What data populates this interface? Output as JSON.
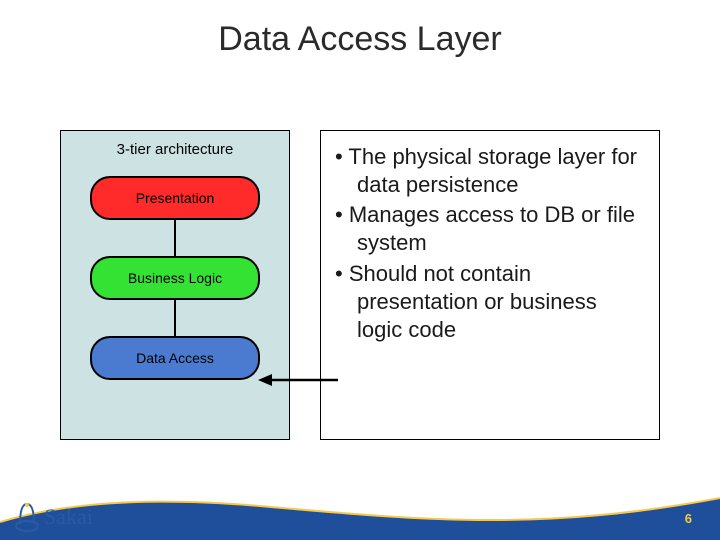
{
  "slide": {
    "title": "Data Access Layer",
    "page_number": "6"
  },
  "diagram": {
    "title": "3-tier architecture",
    "tiers": [
      {
        "label": "Presentation",
        "color": "#ff2a2a"
      },
      {
        "label": "Business Logic",
        "color": "#33e233"
      },
      {
        "label": "Data Access",
        "color": "#4a7bd0"
      }
    ]
  },
  "bullets": [
    "The physical storage layer for data persistence",
    "Manages access to DB or file system",
    "Should not contain presentation or business logic code"
  ],
  "logo": {
    "text": "Sakai"
  },
  "colors": {
    "wave": "#1f4e9b",
    "accent": "#f7c94b"
  }
}
